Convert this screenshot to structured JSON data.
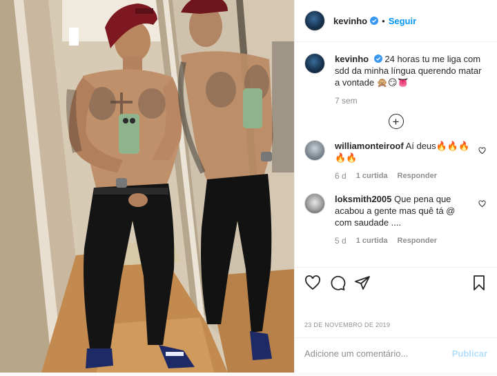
{
  "post": {
    "author": "kevinho",
    "follow_label": "Seguir",
    "separator": "•",
    "caption": {
      "author": "kevinho",
      "text": "24 horas tu me liga com sdd da minha língua querendo matar a vontade 🙊😏👅",
      "time": "7 sem"
    },
    "load_more": "+",
    "comments": [
      {
        "user": "williamonteiroof",
        "text": "Aí deus🔥🔥🔥🔥🔥",
        "time": "6 d",
        "likes": "1 curtida",
        "reply": "Responder"
      },
      {
        "user": "loksmith2005",
        "text": "Que pena que acabou a gente mas quê tá @ com saudade ....",
        "time": "5 d",
        "likes": "1 curtida",
        "reply": "Responder"
      }
    ],
    "date": "23 DE NOVEMBRO DE 2019",
    "comment_input": {
      "placeholder": "Adicione um comentário...",
      "value": ""
    },
    "publish_label": "Publicar"
  },
  "icons": {
    "verified": "verified-badge-icon",
    "like": "heart-icon",
    "comment": "speech-bubble-icon",
    "share": "paper-plane-icon",
    "save": "bookmark-icon"
  },
  "colors": {
    "link": "#0095f6",
    "publish_disabled": "#b2dffc",
    "muted": "#8e8e8e"
  }
}
